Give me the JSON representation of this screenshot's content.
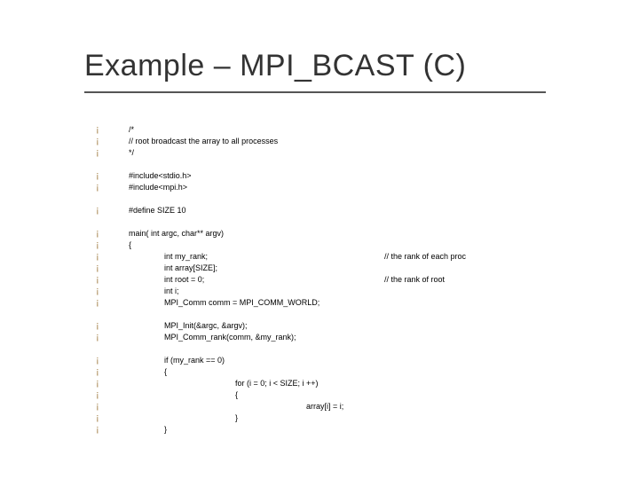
{
  "title": "Example – MPI_BCAST (C)",
  "bullet_char": "¡",
  "lines": [
    {
      "kind": "code",
      "indent": 1,
      "text": "/*"
    },
    {
      "kind": "code",
      "indent": 1,
      "text": "// root broadcast the array to all processes"
    },
    {
      "kind": "code",
      "indent": 1,
      "text": "*/"
    },
    {
      "kind": "blank"
    },
    {
      "kind": "code",
      "indent": 1,
      "text": "#include<stdio.h>"
    },
    {
      "kind": "code",
      "indent": 1,
      "text": "#include<mpi.h>"
    },
    {
      "kind": "blank"
    },
    {
      "kind": "code",
      "indent": 1,
      "text": "#define SIZE 10"
    },
    {
      "kind": "blank"
    },
    {
      "kind": "code",
      "indent": 1,
      "text": "main( int argc, char** argv)"
    },
    {
      "kind": "code",
      "indent": 1,
      "text": "{"
    },
    {
      "kind": "code",
      "indent": 2,
      "text": "int my_rank;",
      "comment": "// the rank of each proc"
    },
    {
      "kind": "code",
      "indent": 2,
      "text": "int array[SIZE];"
    },
    {
      "kind": "code",
      "indent": 2,
      "text": "int root = 0;",
      "comment": "// the rank of root"
    },
    {
      "kind": "code",
      "indent": 2,
      "text": "int i;"
    },
    {
      "kind": "code",
      "indent": 2,
      "text": "MPI_Comm comm = MPI_COMM_WORLD;"
    },
    {
      "kind": "blank"
    },
    {
      "kind": "code",
      "indent": 2,
      "text": "MPI_Init(&argc, &argv);"
    },
    {
      "kind": "code",
      "indent": 2,
      "text": "MPI_Comm_rank(comm, &my_rank);"
    },
    {
      "kind": "blank"
    },
    {
      "kind": "code",
      "indent": 2,
      "text": "if (my_rank == 0)"
    },
    {
      "kind": "code",
      "indent": 2,
      "text": "{"
    },
    {
      "kind": "code",
      "indent": 4,
      "text": "for (i = 0; i < SIZE; i ++)"
    },
    {
      "kind": "code",
      "indent": 4,
      "text": "{"
    },
    {
      "kind": "code",
      "indent": 6,
      "text": "array[i] = i;"
    },
    {
      "kind": "code",
      "indent": 4,
      "text": "}"
    },
    {
      "kind": "code",
      "indent": 2,
      "text": "}"
    }
  ]
}
